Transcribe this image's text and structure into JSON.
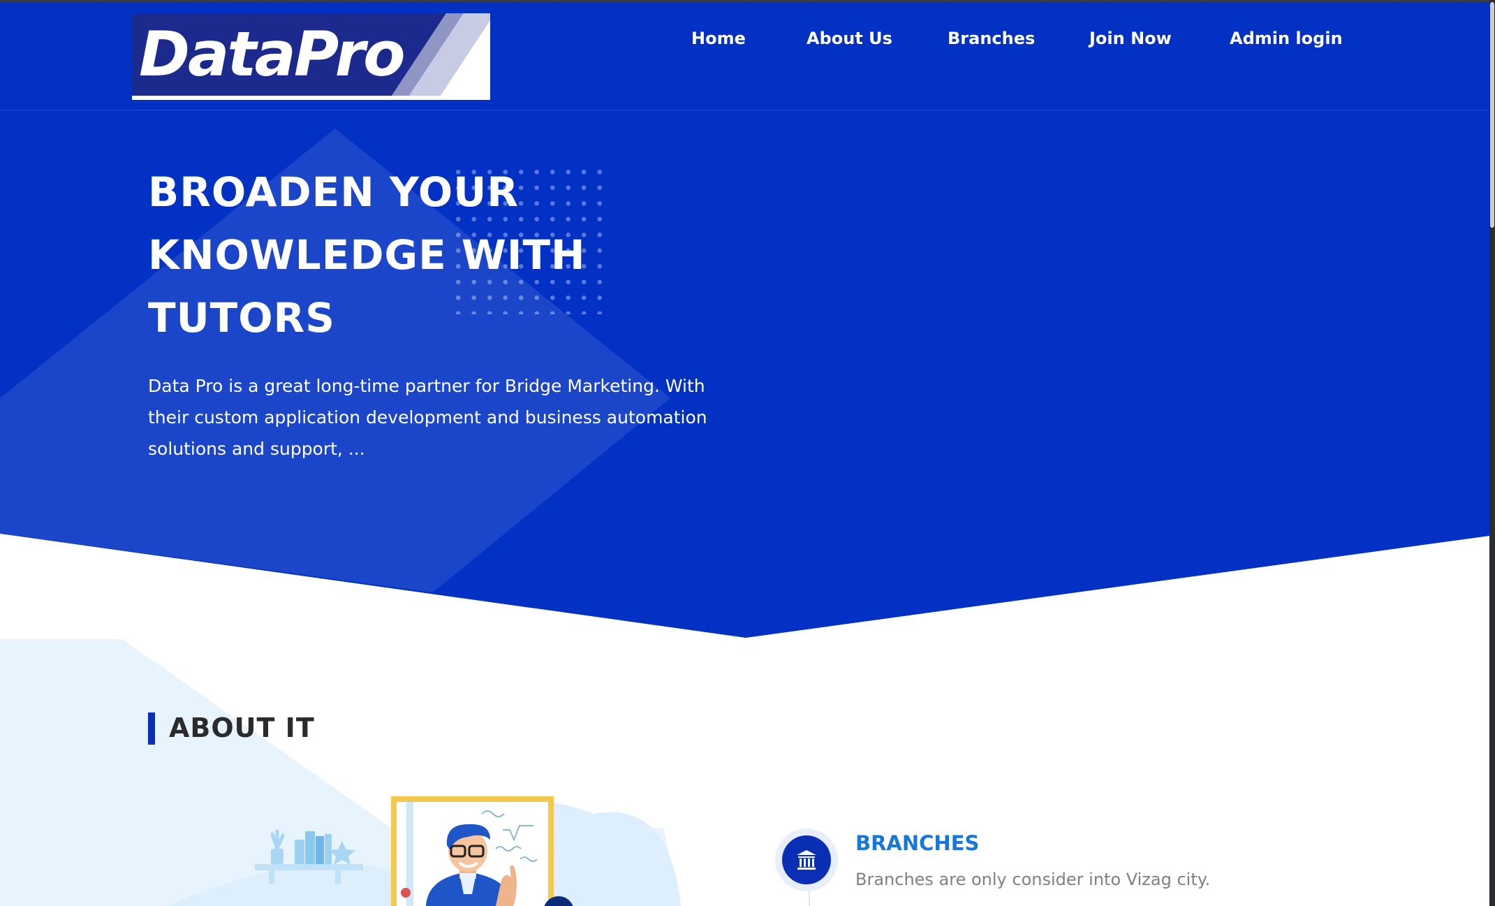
{
  "brand": {
    "logo_text": "DataPro",
    "primary_color": "#0231c3",
    "accent_color": "#1a76d8"
  },
  "nav": {
    "items": [
      {
        "label": "Home"
      },
      {
        "label": "About Us"
      },
      {
        "label": "Branches"
      },
      {
        "label": "Join Now"
      },
      {
        "label": "Admin login"
      }
    ]
  },
  "hero": {
    "title_lines": [
      "BROADEN YOUR",
      "KNOWLEDGE WITH",
      "TUTORS"
    ],
    "description": "Data Pro is a great long-time partner for Bridge Marketing. With their custom application development and business automation solutions and support, ..."
  },
  "about": {
    "heading": "ABOUT IT",
    "features": [
      {
        "icon": "bank-icon",
        "title": "BRANCHES",
        "description": "Branches are only consider into Vizag city."
      }
    ]
  }
}
